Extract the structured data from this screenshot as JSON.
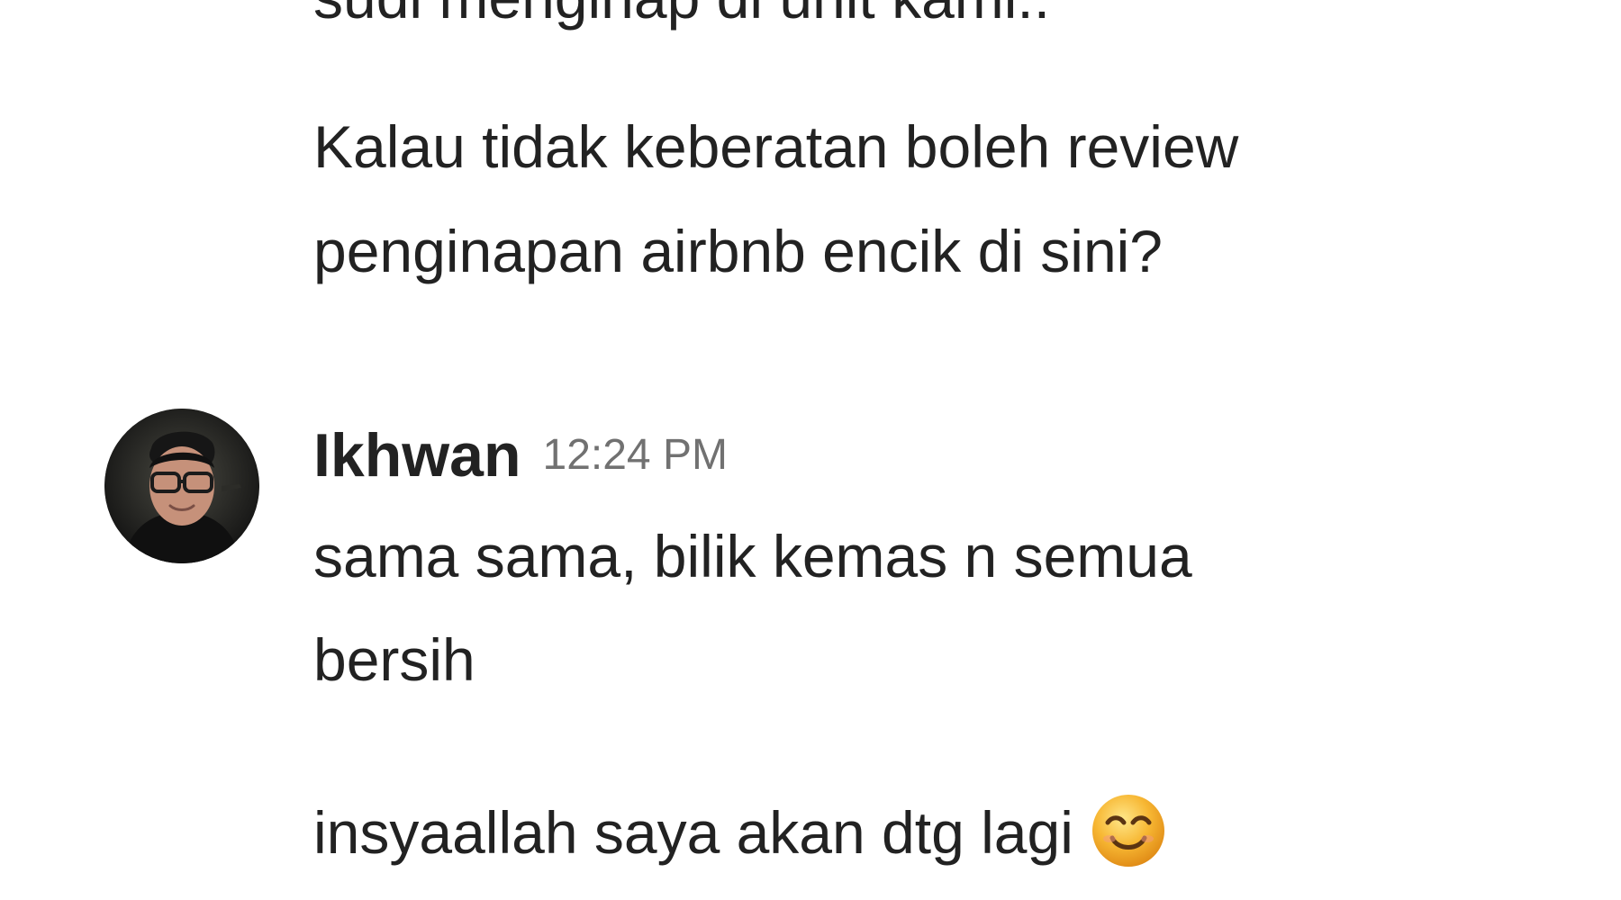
{
  "conversation": {
    "previous_message": {
      "cut_off_line": "sudi menginap di unit kami..",
      "lines": [
        "Kalau tidak keberatan boleh review",
        "penginapan airbnb encik di sini?"
      ]
    },
    "reply": {
      "sender": "Ikhwan",
      "timestamp": "12:24 PM",
      "lines": [
        "sama sama, bilik kemas n semua",
        "bersih",
        "insyaallah saya akan dtg lagi"
      ],
      "emoji": "smiling-face-emoji"
    }
  },
  "colors": {
    "text": "#222222",
    "timestamp": "#717171",
    "background": "#ffffff",
    "emoji": "#f7b733"
  }
}
